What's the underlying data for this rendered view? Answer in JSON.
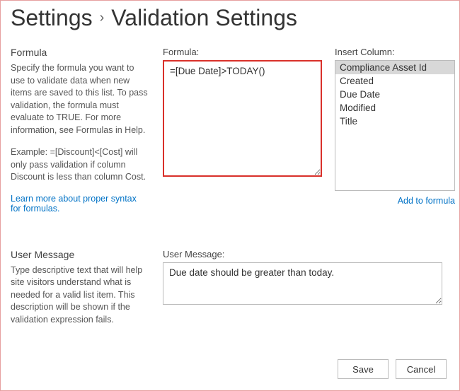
{
  "breadcrumb": {
    "root": "Settings",
    "current": "Validation Settings"
  },
  "formula_section": {
    "title": "Formula",
    "desc": "Specify the formula you want to use to validate data when new items are saved to this list. To pass validation, the formula must evaluate to TRUE. For more information, see Formulas in Help.",
    "example": "Example: =[Discount]<[Cost] will only pass validation if column Discount is less than column Cost.",
    "learn_link": "Learn more about proper syntax for formulas."
  },
  "formula_field": {
    "label": "Formula:",
    "value": "=[Due Date]>TODAY()"
  },
  "insert_column": {
    "label": "Insert Column:",
    "items": [
      "Compliance Asset Id",
      "Created",
      "Due Date",
      "Modified",
      "Title"
    ],
    "selected": 0,
    "add_link": "Add to formula"
  },
  "user_message_section": {
    "title": "User Message",
    "desc": "Type descriptive text that will help site visitors understand what is needed for a valid list item. This description will be shown if the validation expression fails."
  },
  "user_message_field": {
    "label": "User Message:",
    "value": "Due date should be greater than today."
  },
  "buttons": {
    "save": "Save",
    "cancel": "Cancel"
  }
}
